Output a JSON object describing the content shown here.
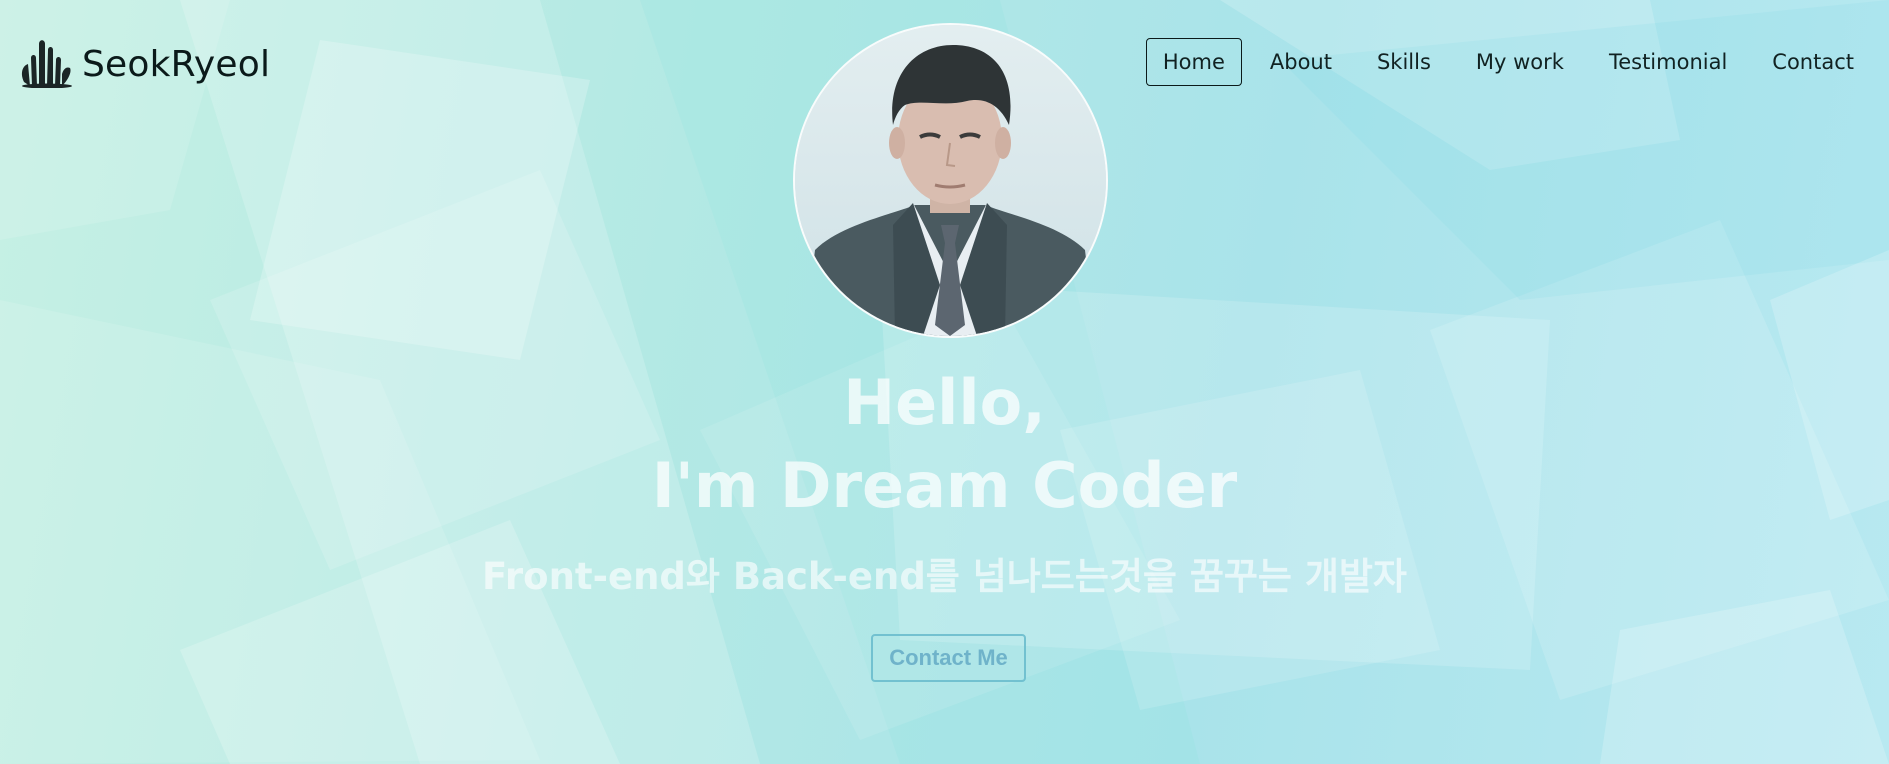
{
  "brand": {
    "title": "SeokRyeol"
  },
  "nav": {
    "items": [
      {
        "label": "Home",
        "active": true
      },
      {
        "label": "About"
      },
      {
        "label": "Skills"
      },
      {
        "label": "My work"
      },
      {
        "label": "Testimonial"
      },
      {
        "label": "Contact"
      }
    ]
  },
  "hero": {
    "greeting": "Hello,",
    "name": "I'm Dream Coder",
    "description": "Front-end와 Back-end를 넘나드는것을 꿈꾸는 개발자",
    "contact_button": "Contact Me"
  },
  "colors": {
    "bg_start": "#c6f0e4",
    "bg_end": "#b8e9f1",
    "button_accent": "#6cbccd",
    "nav_active_border": "#0b1a1a"
  },
  "icons": {
    "logo": "hand-logo-icon"
  }
}
